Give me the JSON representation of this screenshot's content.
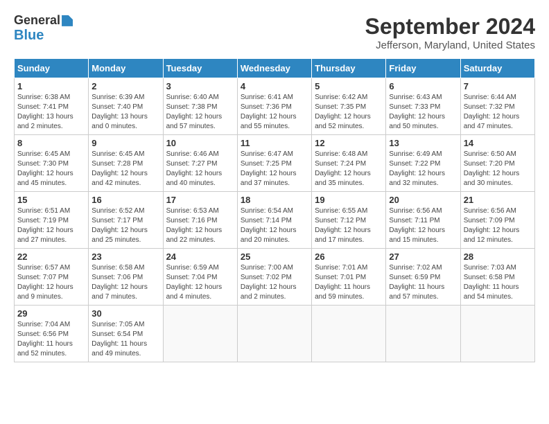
{
  "logo": {
    "general": "General",
    "blue": "Blue"
  },
  "title": "September 2024",
  "subtitle": "Jefferson, Maryland, United States",
  "headers": [
    "Sunday",
    "Monday",
    "Tuesday",
    "Wednesday",
    "Thursday",
    "Friday",
    "Saturday"
  ],
  "weeks": [
    [
      {
        "day": 1,
        "sunrise": "6:38 AM",
        "sunset": "7:41 PM",
        "daylight": "13 hours and 2 minutes."
      },
      {
        "day": 2,
        "sunrise": "6:39 AM",
        "sunset": "7:40 PM",
        "daylight": "13 hours and 0 minutes."
      },
      {
        "day": 3,
        "sunrise": "6:40 AM",
        "sunset": "7:38 PM",
        "daylight": "12 hours and 57 minutes."
      },
      {
        "day": 4,
        "sunrise": "6:41 AM",
        "sunset": "7:36 PM",
        "daylight": "12 hours and 55 minutes."
      },
      {
        "day": 5,
        "sunrise": "6:42 AM",
        "sunset": "7:35 PM",
        "daylight": "12 hours and 52 minutes."
      },
      {
        "day": 6,
        "sunrise": "6:43 AM",
        "sunset": "7:33 PM",
        "daylight": "12 hours and 50 minutes."
      },
      {
        "day": 7,
        "sunrise": "6:44 AM",
        "sunset": "7:32 PM",
        "daylight": "12 hours and 47 minutes."
      }
    ],
    [
      {
        "day": 8,
        "sunrise": "6:45 AM",
        "sunset": "7:30 PM",
        "daylight": "12 hours and 45 minutes."
      },
      {
        "day": 9,
        "sunrise": "6:45 AM",
        "sunset": "7:28 PM",
        "daylight": "12 hours and 42 minutes."
      },
      {
        "day": 10,
        "sunrise": "6:46 AM",
        "sunset": "7:27 PM",
        "daylight": "12 hours and 40 minutes."
      },
      {
        "day": 11,
        "sunrise": "6:47 AM",
        "sunset": "7:25 PM",
        "daylight": "12 hours and 37 minutes."
      },
      {
        "day": 12,
        "sunrise": "6:48 AM",
        "sunset": "7:24 PM",
        "daylight": "12 hours and 35 minutes."
      },
      {
        "day": 13,
        "sunrise": "6:49 AM",
        "sunset": "7:22 PM",
        "daylight": "12 hours and 32 minutes."
      },
      {
        "day": 14,
        "sunrise": "6:50 AM",
        "sunset": "7:20 PM",
        "daylight": "12 hours and 30 minutes."
      }
    ],
    [
      {
        "day": 15,
        "sunrise": "6:51 AM",
        "sunset": "7:19 PM",
        "daylight": "12 hours and 27 minutes."
      },
      {
        "day": 16,
        "sunrise": "6:52 AM",
        "sunset": "7:17 PM",
        "daylight": "12 hours and 25 minutes."
      },
      {
        "day": 17,
        "sunrise": "6:53 AM",
        "sunset": "7:16 PM",
        "daylight": "12 hours and 22 minutes."
      },
      {
        "day": 18,
        "sunrise": "6:54 AM",
        "sunset": "7:14 PM",
        "daylight": "12 hours and 20 minutes."
      },
      {
        "day": 19,
        "sunrise": "6:55 AM",
        "sunset": "7:12 PM",
        "daylight": "12 hours and 17 minutes."
      },
      {
        "day": 20,
        "sunrise": "6:56 AM",
        "sunset": "7:11 PM",
        "daylight": "12 hours and 15 minutes."
      },
      {
        "day": 21,
        "sunrise": "6:56 AM",
        "sunset": "7:09 PM",
        "daylight": "12 hours and 12 minutes."
      }
    ],
    [
      {
        "day": 22,
        "sunrise": "6:57 AM",
        "sunset": "7:07 PM",
        "daylight": "12 hours and 9 minutes."
      },
      {
        "day": 23,
        "sunrise": "6:58 AM",
        "sunset": "7:06 PM",
        "daylight": "12 hours and 7 minutes."
      },
      {
        "day": 24,
        "sunrise": "6:59 AM",
        "sunset": "7:04 PM",
        "daylight": "12 hours and 4 minutes."
      },
      {
        "day": 25,
        "sunrise": "7:00 AM",
        "sunset": "7:02 PM",
        "daylight": "12 hours and 2 minutes."
      },
      {
        "day": 26,
        "sunrise": "7:01 AM",
        "sunset": "7:01 PM",
        "daylight": "11 hours and 59 minutes."
      },
      {
        "day": 27,
        "sunrise": "7:02 AM",
        "sunset": "6:59 PM",
        "daylight": "11 hours and 57 minutes."
      },
      {
        "day": 28,
        "sunrise": "7:03 AM",
        "sunset": "6:58 PM",
        "daylight": "11 hours and 54 minutes."
      }
    ],
    [
      {
        "day": 29,
        "sunrise": "7:04 AM",
        "sunset": "6:56 PM",
        "daylight": "11 hours and 52 minutes."
      },
      {
        "day": 30,
        "sunrise": "7:05 AM",
        "sunset": "6:54 PM",
        "daylight": "11 hours and 49 minutes."
      },
      null,
      null,
      null,
      null,
      null
    ]
  ]
}
